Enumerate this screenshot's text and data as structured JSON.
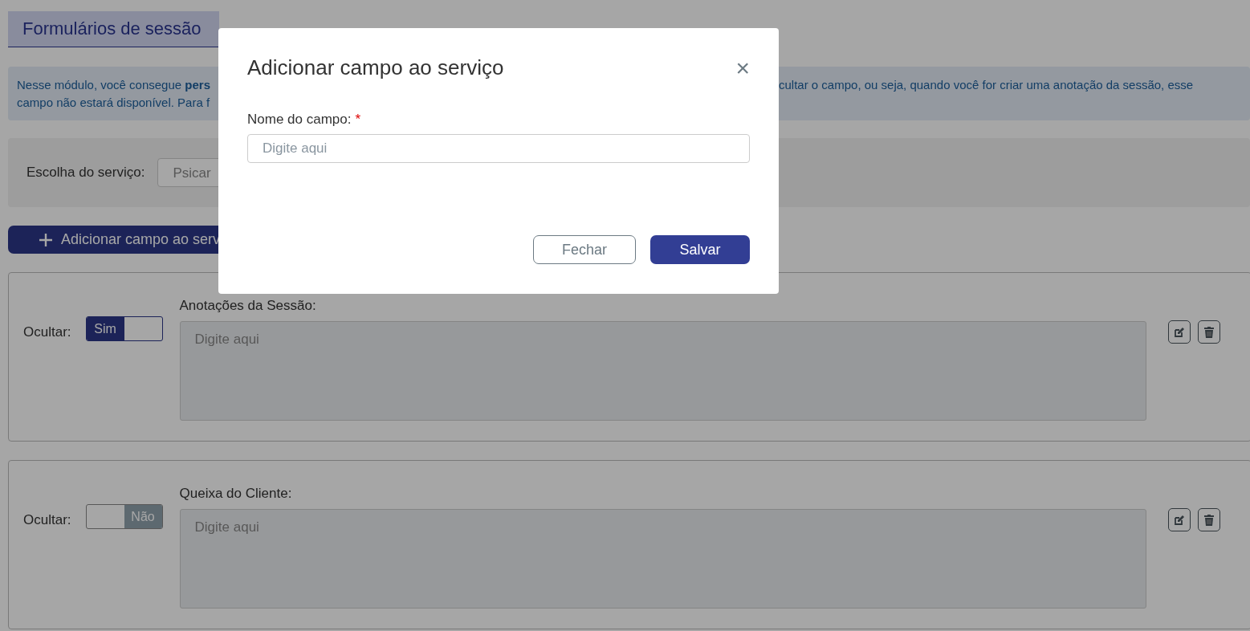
{
  "page_title": "Formulários de sessão",
  "info": {
    "left_lines": [
      "Nesse módulo, você consegue **pers**",
      "campo não estará disponível. Para f"
    ],
    "right_lines": [
      "cultar o campo, ou seja, quando você for criar uma anotação da sessão, esse"
    ]
  },
  "service": {
    "label": "Escolha do serviço:",
    "value": "Psicar"
  },
  "add_button": "Adicionar campo ao serv",
  "fields": [
    {
      "hide_label": "Ocultar:",
      "toggle_label": "Sim",
      "on": true,
      "label": "Anotações da Sessão:",
      "placeholder": "Digite aqui"
    },
    {
      "hide_label": "Ocultar:",
      "toggle_label": "Não",
      "on": false,
      "label": "Queixa do Cliente:",
      "placeholder": "Digite aqui"
    }
  ],
  "modal": {
    "title": "Adicionar campo ao serviço",
    "close": "×",
    "field_label": "Nome do campo:",
    "required_mark": "*",
    "placeholder": "Digite aqui",
    "buttons": [
      {
        "label": "Fechar",
        "kind": "secondary"
      },
      {
        "label": "Salvar",
        "kind": "primary"
      }
    ]
  }
}
